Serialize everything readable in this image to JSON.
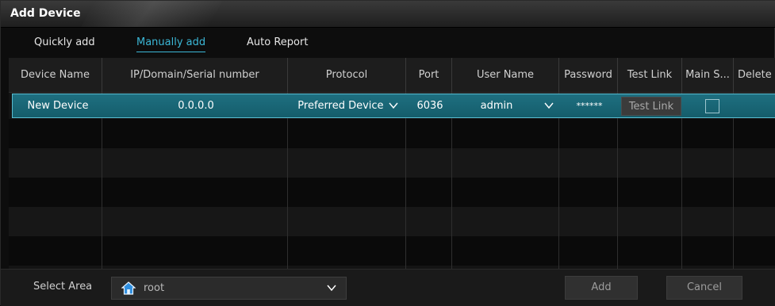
{
  "window": {
    "title": "Add Device"
  },
  "tabs": [
    {
      "label": "Quickly add",
      "active": false
    },
    {
      "label": "Manually add",
      "active": true
    },
    {
      "label": "Auto Report",
      "active": false
    }
  ],
  "table": {
    "columns": [
      "Device Name",
      "IP/Domain/Serial number",
      "Protocol",
      "Port",
      "User Name",
      "Password",
      "Test Link",
      "Main S...",
      "Delete"
    ],
    "rows": [
      {
        "device_name": "New Device",
        "ip": "0.0.0.0",
        "protocol": "Preferred Device",
        "port": "6036",
        "user_name": "admin",
        "password": "******",
        "test_link_label": "Test Link",
        "main_stream_checked": false
      }
    ]
  },
  "footer": {
    "select_area_label": "Select Area",
    "area_value": "root",
    "add_label": "Add",
    "cancel_label": "Cancel"
  },
  "colors": {
    "accent": "#3bb7d6",
    "selected_row": "#1a6677",
    "selected_row_border": "#58bcd0"
  },
  "icons": {
    "area": "home-icon",
    "dropdown": "chevron-down-icon"
  }
}
